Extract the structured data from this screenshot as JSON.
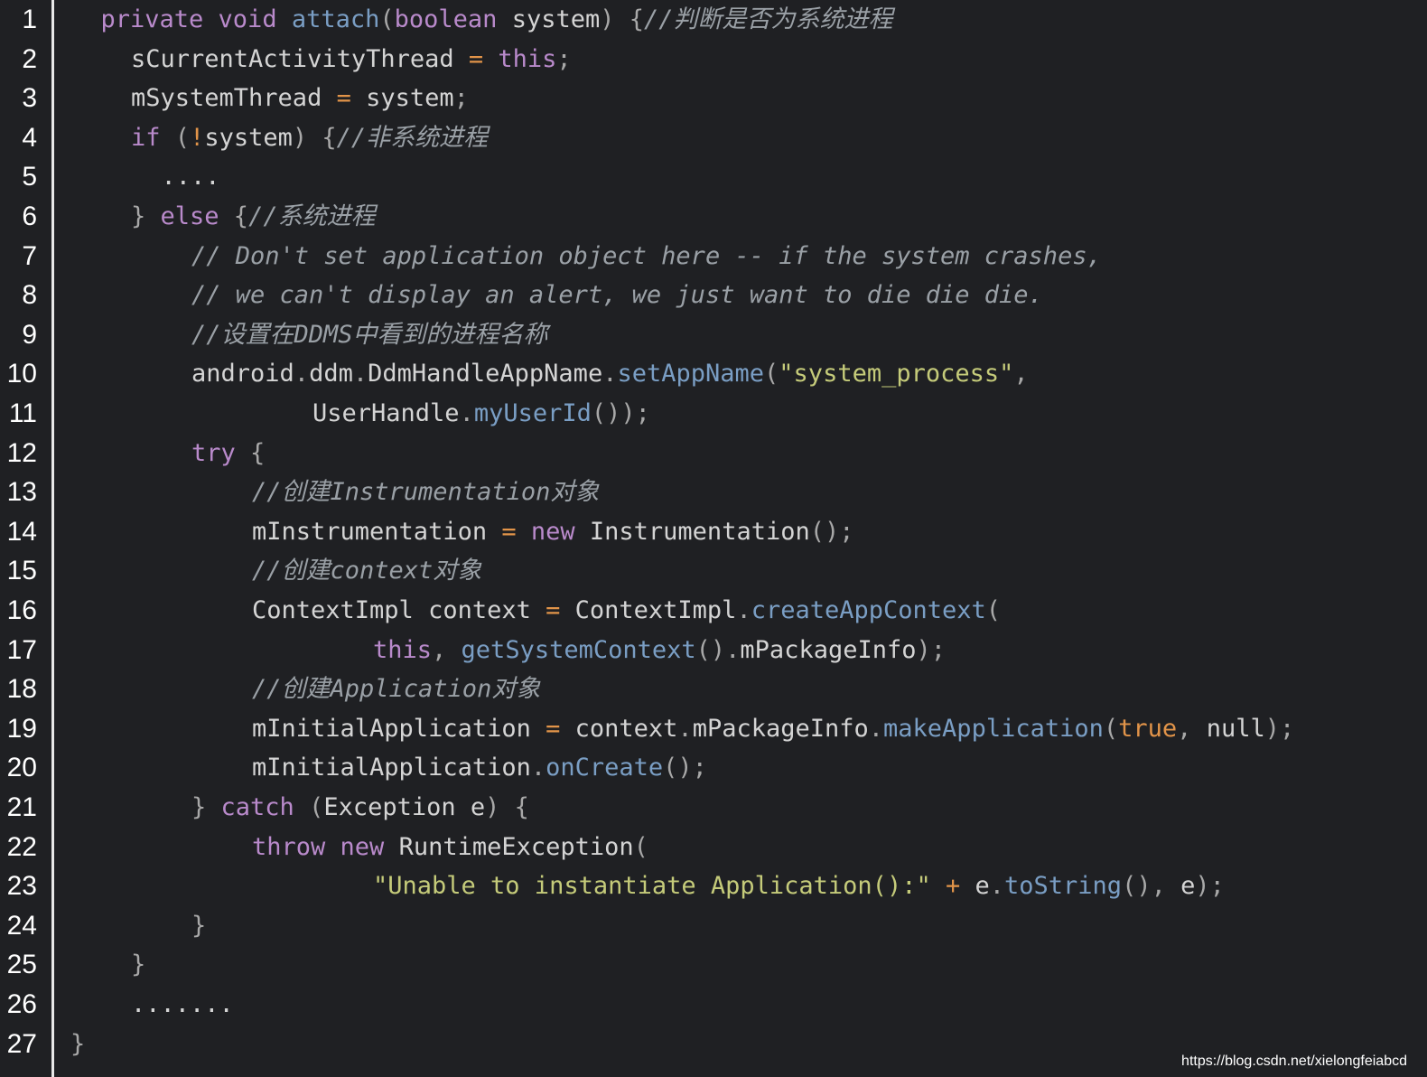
{
  "colors": {
    "background": "#1f2023",
    "line_number": "#ffffff",
    "gutter_border": "#e8e8e8",
    "keyword": "#b98acb",
    "function": "#7a9ec4",
    "string": "#c5cb7a",
    "operator": "#e29449",
    "comment": "#9aa0a6",
    "plain": "#d4d4d4"
  },
  "code": {
    "language": "java",
    "lines": [
      {
        "n": "1",
        "indent": 1,
        "tokens": [
          [
            "kw",
            "private "
          ],
          [
            "kw",
            "void "
          ],
          [
            "fn",
            "attach"
          ],
          [
            "punc",
            "("
          ],
          [
            "kw",
            "boolean "
          ],
          [
            "plain",
            "system"
          ],
          [
            "punc",
            ") {"
          ],
          [
            "cm",
            "//判断是否为系统进程"
          ]
        ]
      },
      {
        "n": "2",
        "indent": 2,
        "tokens": [
          [
            "plain",
            "sCurrentActivityThread "
          ],
          [
            "op",
            "= "
          ],
          [
            "kw",
            "this"
          ],
          [
            "punc",
            ";"
          ]
        ]
      },
      {
        "n": "3",
        "indent": 2,
        "tokens": [
          [
            "plain",
            "mSystemThread "
          ],
          [
            "op",
            "= "
          ],
          [
            "plain",
            "system"
          ],
          [
            "punc",
            ";"
          ]
        ]
      },
      {
        "n": "4",
        "indent": 2,
        "tokens": [
          [
            "kw",
            "if "
          ],
          [
            "punc",
            "("
          ],
          [
            "op",
            "!"
          ],
          [
            "plain",
            "system"
          ],
          [
            "punc",
            ") {"
          ],
          [
            "cm",
            "//非系统进程"
          ]
        ]
      },
      {
        "n": "5",
        "indent": 3,
        "tokens": [
          [
            "plain",
            "...."
          ]
        ]
      },
      {
        "n": "6",
        "indent": 2,
        "tokens": [
          [
            "punc",
            "} "
          ],
          [
            "kw",
            "else "
          ],
          [
            "punc",
            "{"
          ],
          [
            "cm",
            "//系统进程"
          ]
        ]
      },
      {
        "n": "7",
        "indent": 4,
        "tokens": [
          [
            "cm",
            "// Don't set application object here -- if the system crashes,"
          ]
        ]
      },
      {
        "n": "8",
        "indent": 4,
        "tokens": [
          [
            "cm",
            "// we can't display an alert, we just want to die die die."
          ]
        ]
      },
      {
        "n": "9",
        "indent": 4,
        "tokens": [
          [
            "cm",
            "//设置在DDMS中看到的进程名称"
          ]
        ]
      },
      {
        "n": "10",
        "indent": 4,
        "tokens": [
          [
            "plain",
            "android"
          ],
          [
            "punc",
            "."
          ],
          [
            "plain",
            "ddm"
          ],
          [
            "punc",
            "."
          ],
          [
            "plain",
            "DdmHandleAppName"
          ],
          [
            "punc",
            "."
          ],
          [
            "fn",
            "setAppName"
          ],
          [
            "punc",
            "("
          ],
          [
            "str",
            "\"system_process\""
          ],
          [
            "punc",
            ","
          ]
        ]
      },
      {
        "n": "11",
        "indent": 8,
        "tokens": [
          [
            "plain",
            "UserHandle"
          ],
          [
            "punc",
            "."
          ],
          [
            "fn",
            "myUserId"
          ],
          [
            "punc",
            "());"
          ]
        ]
      },
      {
        "n": "12",
        "indent": 4,
        "tokens": [
          [
            "kw",
            "try "
          ],
          [
            "punc",
            "{"
          ]
        ]
      },
      {
        "n": "13",
        "indent": 6,
        "tokens": [
          [
            "cm",
            "//创建Instrumentation对象"
          ]
        ]
      },
      {
        "n": "14",
        "indent": 6,
        "tokens": [
          [
            "plain",
            "mInstrumentation "
          ],
          [
            "op",
            "= "
          ],
          [
            "kw",
            "new "
          ],
          [
            "plain",
            "Instrumentation"
          ],
          [
            "punc",
            "();"
          ]
        ]
      },
      {
        "n": "15",
        "indent": 6,
        "tokens": [
          [
            "cm",
            "//创建context对象"
          ]
        ]
      },
      {
        "n": "16",
        "indent": 6,
        "tokens": [
          [
            "plain",
            "ContextImpl context "
          ],
          [
            "op",
            "= "
          ],
          [
            "plain",
            "ContextImpl"
          ],
          [
            "punc",
            "."
          ],
          [
            "fn",
            "createAppContext"
          ],
          [
            "punc",
            "("
          ]
        ]
      },
      {
        "n": "17",
        "indent": 10,
        "tokens": [
          [
            "kw",
            "this"
          ],
          [
            "punc",
            ", "
          ],
          [
            "fn",
            "getSystemContext"
          ],
          [
            "punc",
            "()."
          ],
          [
            "plain",
            "mPackageInfo"
          ],
          [
            "punc",
            ");"
          ]
        ]
      },
      {
        "n": "18",
        "indent": 6,
        "tokens": [
          [
            "cm",
            "//创建Application对象"
          ]
        ]
      },
      {
        "n": "19",
        "indent": 6,
        "tokens": [
          [
            "plain",
            "mInitialApplication "
          ],
          [
            "op",
            "= "
          ],
          [
            "plain",
            "context"
          ],
          [
            "punc",
            "."
          ],
          [
            "plain",
            "mPackageInfo"
          ],
          [
            "punc",
            "."
          ],
          [
            "fn",
            "makeApplication"
          ],
          [
            "punc",
            "("
          ],
          [
            "bool",
            "true"
          ],
          [
            "punc",
            ", "
          ],
          [
            "plain",
            "null"
          ],
          [
            "punc",
            ");"
          ]
        ]
      },
      {
        "n": "20",
        "indent": 6,
        "tokens": [
          [
            "plain",
            "mInitialApplication"
          ],
          [
            "punc",
            "."
          ],
          [
            "fn",
            "onCreate"
          ],
          [
            "punc",
            "();"
          ]
        ]
      },
      {
        "n": "21",
        "indent": 4,
        "tokens": [
          [
            "punc",
            "} "
          ],
          [
            "kw",
            "catch "
          ],
          [
            "punc",
            "("
          ],
          [
            "plain",
            "Exception e"
          ],
          [
            "punc",
            ") {"
          ]
        ]
      },
      {
        "n": "22",
        "indent": 6,
        "tokens": [
          [
            "kw",
            "throw "
          ],
          [
            "kw",
            "new "
          ],
          [
            "plain",
            "RuntimeException"
          ],
          [
            "punc",
            "("
          ]
        ]
      },
      {
        "n": "23",
        "indent": 10,
        "tokens": [
          [
            "str",
            "\"Unable to instantiate Application():\" "
          ],
          [
            "op",
            "+ "
          ],
          [
            "plain",
            "e"
          ],
          [
            "punc",
            "."
          ],
          [
            "fn",
            "toString"
          ],
          [
            "punc",
            "(), "
          ],
          [
            "plain",
            "e"
          ],
          [
            "punc",
            ");"
          ]
        ]
      },
      {
        "n": "24",
        "indent": 4,
        "tokens": [
          [
            "punc",
            "}"
          ]
        ]
      },
      {
        "n": "25",
        "indent": 2,
        "tokens": [
          [
            "punc",
            "}"
          ]
        ]
      },
      {
        "n": "26",
        "indent": 2,
        "tokens": [
          [
            "plain",
            "......."
          ]
        ]
      },
      {
        "n": "27",
        "indent": 0,
        "tokens": [
          [
            "punc",
            "}"
          ]
        ]
      }
    ]
  },
  "watermark": "https://blog.csdn.net/xielongfeiabcd"
}
